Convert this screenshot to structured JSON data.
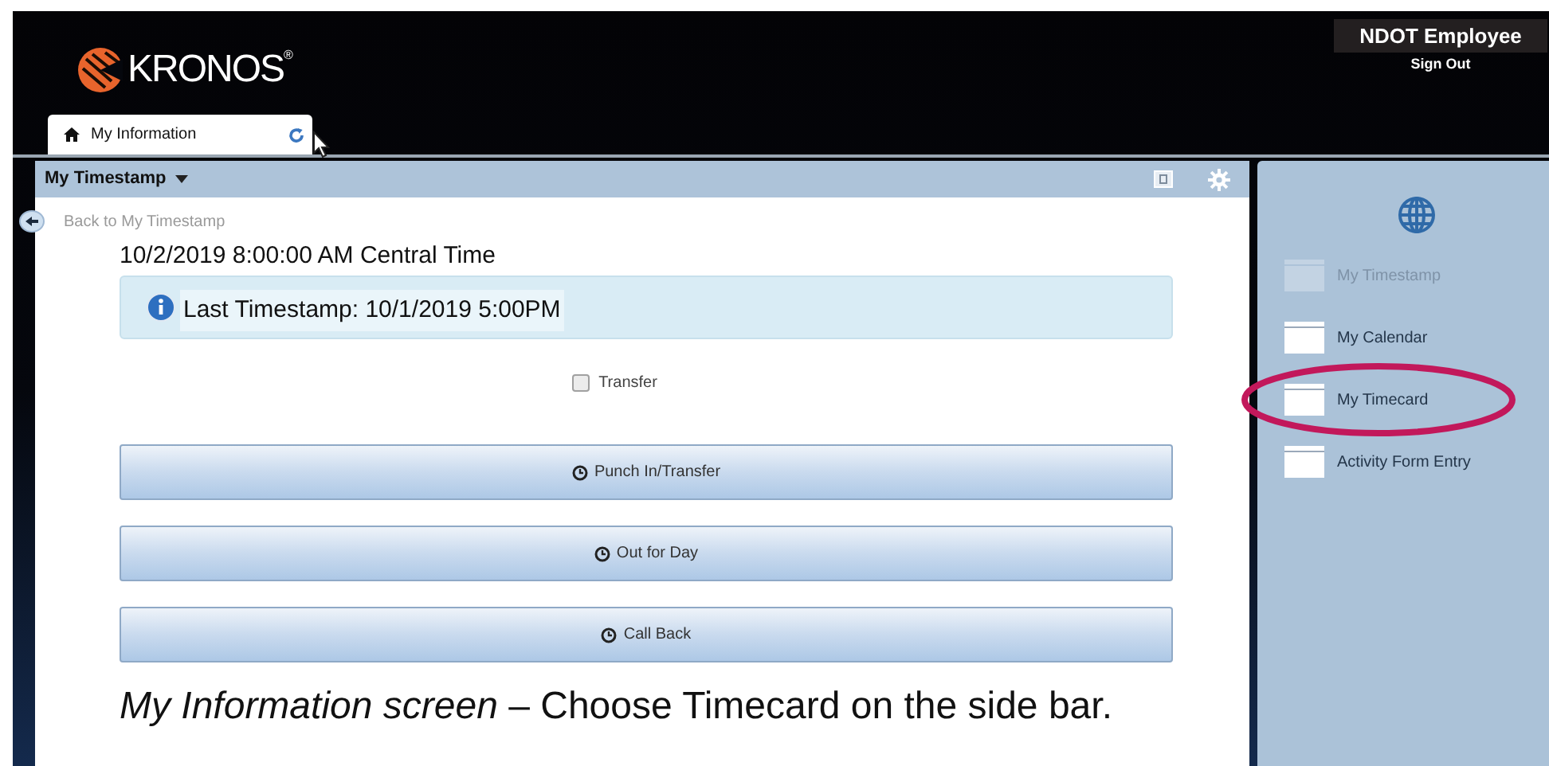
{
  "header": {
    "logo": "KRONOS",
    "logo_mark": "®",
    "user": "NDOT Employee",
    "sign_out": "Sign Out"
  },
  "tabs": [
    {
      "label": "My Information",
      "selected": true
    }
  ],
  "panel": {
    "title": "My Timestamp",
    "back_link": "Back to My Timestamp",
    "current_time": "10/2/2019 8:00:00 AM Central Time",
    "info": "Last Timestamp: 10/1/2019 5:00PM",
    "transfer": {
      "label": "Transfer",
      "checked": false
    },
    "buttons": [
      "Punch In/Transfer",
      "Out for Day",
      "Call Back"
    ]
  },
  "sidebar": {
    "items": [
      {
        "label": "My Timestamp",
        "disabled": true,
        "circled": false
      },
      {
        "label": "My Calendar",
        "disabled": false,
        "circled": false
      },
      {
        "label": "My Timecard",
        "disabled": false,
        "circled": true
      },
      {
        "label": "Activity Form Entry",
        "disabled": false,
        "circled": false
      }
    ]
  },
  "caption": "*My Information screen* – Choose Timecard on the side bar."
}
